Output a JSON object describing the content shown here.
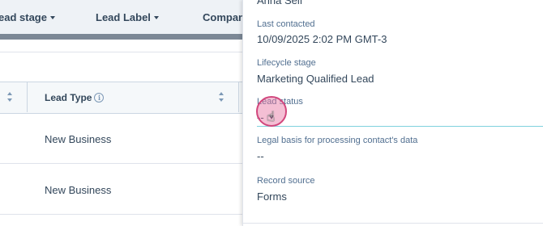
{
  "table": {
    "filters": [
      {
        "label": "ead stage"
      },
      {
        "label": "Lead Label"
      },
      {
        "label": "Compan"
      }
    ],
    "column_header": {
      "label": "Lead Type",
      "info_icon": "info-icon"
    },
    "rows": [
      {
        "lead_type": "New Business"
      },
      {
        "lead_type": "New Business"
      }
    ]
  },
  "panel": {
    "top_partial_value": "Anna Seif",
    "fields": [
      {
        "label": "Last contacted",
        "value": "10/09/2025 2:02 PM GMT-3"
      },
      {
        "label": "Lifecycle stage",
        "value": "Marketing Qualified Lead"
      },
      {
        "label": "Lead status",
        "value": "--"
      },
      {
        "label": "Legal basis for processing contact's data",
        "value": "--"
      },
      {
        "label": "Record source",
        "value": "Forms"
      }
    ]
  },
  "colors": {
    "accent_underline": "#7fd1de",
    "cursor_highlight": "#d2477d",
    "text": "#33475b",
    "label": "#516f90"
  },
  "icons": {
    "cursor": "hand-pointer-icon",
    "dropdown": "caret-down-icon",
    "sort": "sort-icon"
  }
}
